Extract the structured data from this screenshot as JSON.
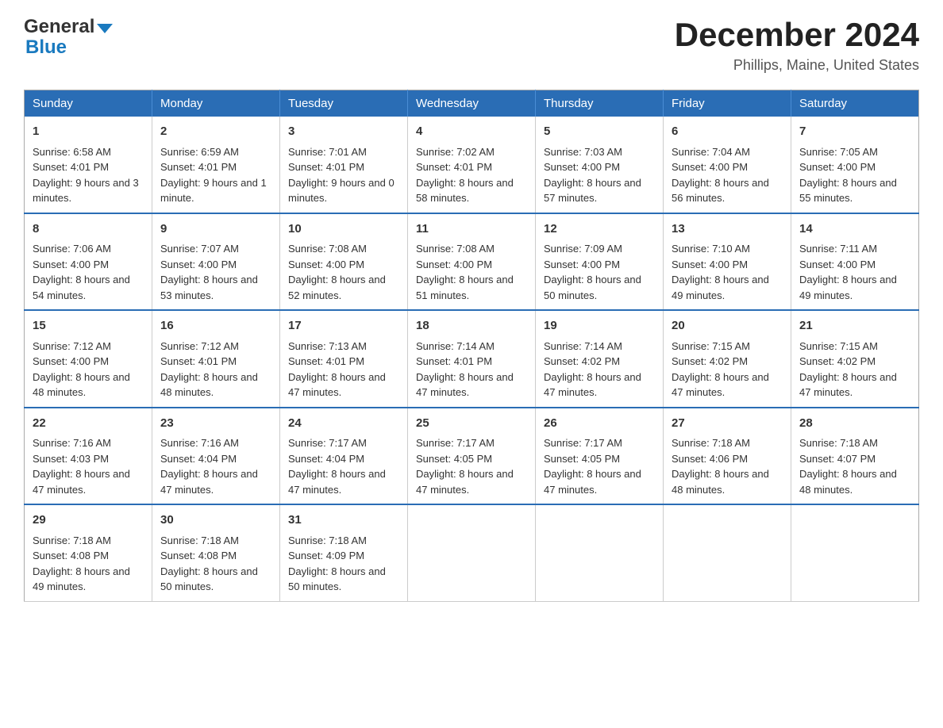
{
  "header": {
    "logo_general": "General",
    "logo_blue": "Blue",
    "title": "December 2024",
    "subtitle": "Phillips, Maine, United States"
  },
  "days_of_week": [
    "Sunday",
    "Monday",
    "Tuesday",
    "Wednesday",
    "Thursday",
    "Friday",
    "Saturday"
  ],
  "weeks": [
    [
      {
        "day": "1",
        "sunrise": "6:58 AM",
        "sunset": "4:01 PM",
        "daylight": "9 hours and 3 minutes."
      },
      {
        "day": "2",
        "sunrise": "6:59 AM",
        "sunset": "4:01 PM",
        "daylight": "9 hours and 1 minute."
      },
      {
        "day": "3",
        "sunrise": "7:01 AM",
        "sunset": "4:01 PM",
        "daylight": "9 hours and 0 minutes."
      },
      {
        "day": "4",
        "sunrise": "7:02 AM",
        "sunset": "4:01 PM",
        "daylight": "8 hours and 58 minutes."
      },
      {
        "day": "5",
        "sunrise": "7:03 AM",
        "sunset": "4:00 PM",
        "daylight": "8 hours and 57 minutes."
      },
      {
        "day": "6",
        "sunrise": "7:04 AM",
        "sunset": "4:00 PM",
        "daylight": "8 hours and 56 minutes."
      },
      {
        "day": "7",
        "sunrise": "7:05 AM",
        "sunset": "4:00 PM",
        "daylight": "8 hours and 55 minutes."
      }
    ],
    [
      {
        "day": "8",
        "sunrise": "7:06 AM",
        "sunset": "4:00 PM",
        "daylight": "8 hours and 54 minutes."
      },
      {
        "day": "9",
        "sunrise": "7:07 AM",
        "sunset": "4:00 PM",
        "daylight": "8 hours and 53 minutes."
      },
      {
        "day": "10",
        "sunrise": "7:08 AM",
        "sunset": "4:00 PM",
        "daylight": "8 hours and 52 minutes."
      },
      {
        "day": "11",
        "sunrise": "7:08 AM",
        "sunset": "4:00 PM",
        "daylight": "8 hours and 51 minutes."
      },
      {
        "day": "12",
        "sunrise": "7:09 AM",
        "sunset": "4:00 PM",
        "daylight": "8 hours and 50 minutes."
      },
      {
        "day": "13",
        "sunrise": "7:10 AM",
        "sunset": "4:00 PM",
        "daylight": "8 hours and 49 minutes."
      },
      {
        "day": "14",
        "sunrise": "7:11 AM",
        "sunset": "4:00 PM",
        "daylight": "8 hours and 49 minutes."
      }
    ],
    [
      {
        "day": "15",
        "sunrise": "7:12 AM",
        "sunset": "4:00 PM",
        "daylight": "8 hours and 48 minutes."
      },
      {
        "day": "16",
        "sunrise": "7:12 AM",
        "sunset": "4:01 PM",
        "daylight": "8 hours and 48 minutes."
      },
      {
        "day": "17",
        "sunrise": "7:13 AM",
        "sunset": "4:01 PM",
        "daylight": "8 hours and 47 minutes."
      },
      {
        "day": "18",
        "sunrise": "7:14 AM",
        "sunset": "4:01 PM",
        "daylight": "8 hours and 47 minutes."
      },
      {
        "day": "19",
        "sunrise": "7:14 AM",
        "sunset": "4:02 PM",
        "daylight": "8 hours and 47 minutes."
      },
      {
        "day": "20",
        "sunrise": "7:15 AM",
        "sunset": "4:02 PM",
        "daylight": "8 hours and 47 minutes."
      },
      {
        "day": "21",
        "sunrise": "7:15 AM",
        "sunset": "4:02 PM",
        "daylight": "8 hours and 47 minutes."
      }
    ],
    [
      {
        "day": "22",
        "sunrise": "7:16 AM",
        "sunset": "4:03 PM",
        "daylight": "8 hours and 47 minutes."
      },
      {
        "day": "23",
        "sunrise": "7:16 AM",
        "sunset": "4:04 PM",
        "daylight": "8 hours and 47 minutes."
      },
      {
        "day": "24",
        "sunrise": "7:17 AM",
        "sunset": "4:04 PM",
        "daylight": "8 hours and 47 minutes."
      },
      {
        "day": "25",
        "sunrise": "7:17 AM",
        "sunset": "4:05 PM",
        "daylight": "8 hours and 47 minutes."
      },
      {
        "day": "26",
        "sunrise": "7:17 AM",
        "sunset": "4:05 PM",
        "daylight": "8 hours and 47 minutes."
      },
      {
        "day": "27",
        "sunrise": "7:18 AM",
        "sunset": "4:06 PM",
        "daylight": "8 hours and 48 minutes."
      },
      {
        "day": "28",
        "sunrise": "7:18 AM",
        "sunset": "4:07 PM",
        "daylight": "8 hours and 48 minutes."
      }
    ],
    [
      {
        "day": "29",
        "sunrise": "7:18 AM",
        "sunset": "4:08 PM",
        "daylight": "8 hours and 49 minutes."
      },
      {
        "day": "30",
        "sunrise": "7:18 AM",
        "sunset": "4:08 PM",
        "daylight": "8 hours and 50 minutes."
      },
      {
        "day": "31",
        "sunrise": "7:18 AM",
        "sunset": "4:09 PM",
        "daylight": "8 hours and 50 minutes."
      },
      null,
      null,
      null,
      null
    ]
  ]
}
